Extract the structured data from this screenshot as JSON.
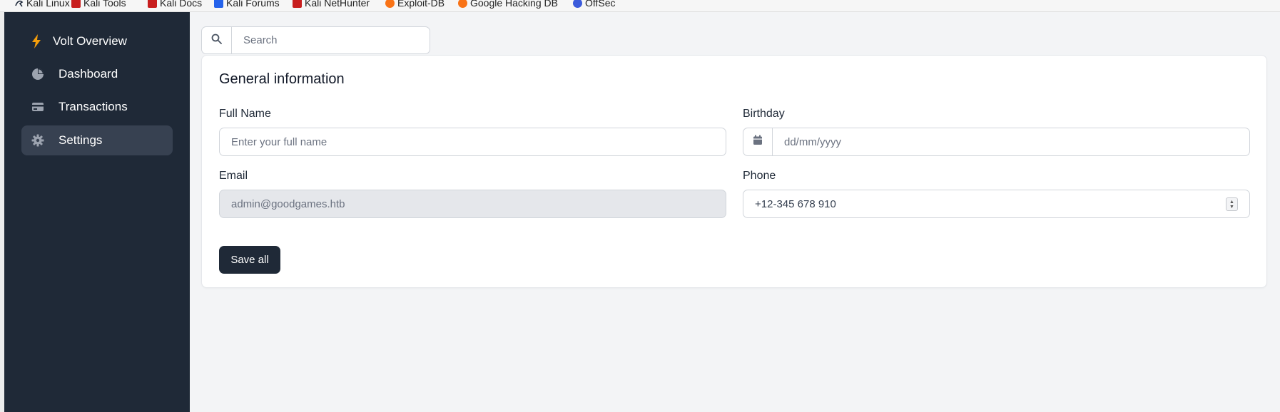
{
  "bookmarks": [
    {
      "label": "Kali Linux",
      "icon": "kali-linux-icon",
      "color": "#1e293b"
    },
    {
      "label": "Kali Tools",
      "icon": "kali-tools-icon",
      "color": "#c81e1e"
    },
    {
      "label": "Kali Docs",
      "icon": "kali-docs-icon",
      "color": "#c81e1e"
    },
    {
      "label": "Kali Forums",
      "icon": "kali-forums-icon",
      "color": "#2563eb"
    },
    {
      "label": "Kali NetHunter",
      "icon": "kali-nethunter-icon",
      "color": "#c81e1e"
    },
    {
      "label": "Exploit-DB",
      "icon": "exploit-db-icon",
      "color": "#f97316"
    },
    {
      "label": "Google Hacking DB",
      "icon": "ghdb-icon",
      "color": "#f97316"
    },
    {
      "label": "OffSec",
      "icon": "offsec-icon",
      "color": "#3b5bdb"
    }
  ],
  "sidebar": {
    "brand": {
      "label": "Volt Overview",
      "icon": "lightning-icon",
      "icon_color": "#f59e0b"
    },
    "items": [
      {
        "label": "Dashboard",
        "icon": "pie-chart-icon",
        "active": false
      },
      {
        "label": "Transactions",
        "icon": "credit-card-icon",
        "active": false
      },
      {
        "label": "Settings",
        "icon": "gear-icon",
        "active": true
      }
    ]
  },
  "search": {
    "placeholder": "Search",
    "icon": "search-icon"
  },
  "card": {
    "title": "General information",
    "full_name": {
      "label": "Full Name",
      "placeholder": "Enter your full name",
      "value": ""
    },
    "birthday": {
      "label": "Birthday",
      "placeholder": "dd/mm/yyyy",
      "icon": "calendar-icon"
    },
    "email": {
      "label": "Email",
      "value": "admin@goodgames.htb",
      "disabled": true
    },
    "phone": {
      "label": "Phone",
      "value": "+12-345 678 910"
    },
    "save_label": "Save all"
  },
  "colors": {
    "sidebar_bg": "#1f2937",
    "active_item_bg": "#374151",
    "primary_button": "#1f2937",
    "page_bg": "#f3f4f6"
  }
}
